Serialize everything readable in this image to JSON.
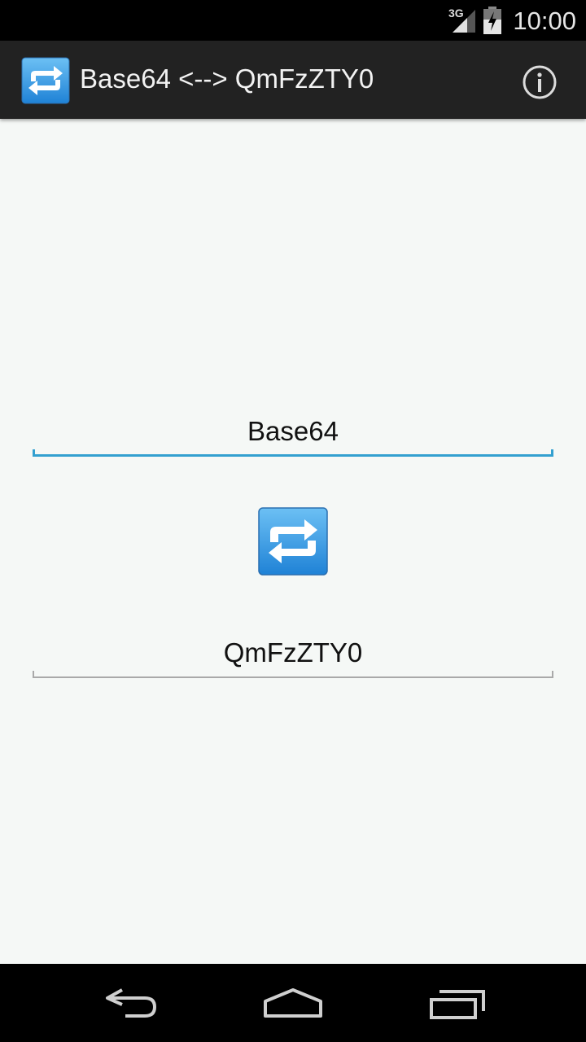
{
  "status_bar": {
    "network": "3G",
    "time": "10:00"
  },
  "action_bar": {
    "title": "Base64 <--> QmFzZTY0",
    "app_icon": "repeat-arrows-icon",
    "info_icon": "info-icon"
  },
  "main": {
    "plain_text_value": "Base64",
    "encoded_value": "QmFzZTY0",
    "swap_icon": "repeat-arrows-icon"
  },
  "nav_bar": {
    "back_icon": "back-icon",
    "home_icon": "home-icon",
    "recents_icon": "recents-icon"
  },
  "colors": {
    "action_bar_bg": "#222222",
    "content_bg": "#f5f8f6",
    "accent_underline": "#33a0d0",
    "inactive_underline": "#a9a9a9",
    "icon_blue": "#3c9be6"
  }
}
